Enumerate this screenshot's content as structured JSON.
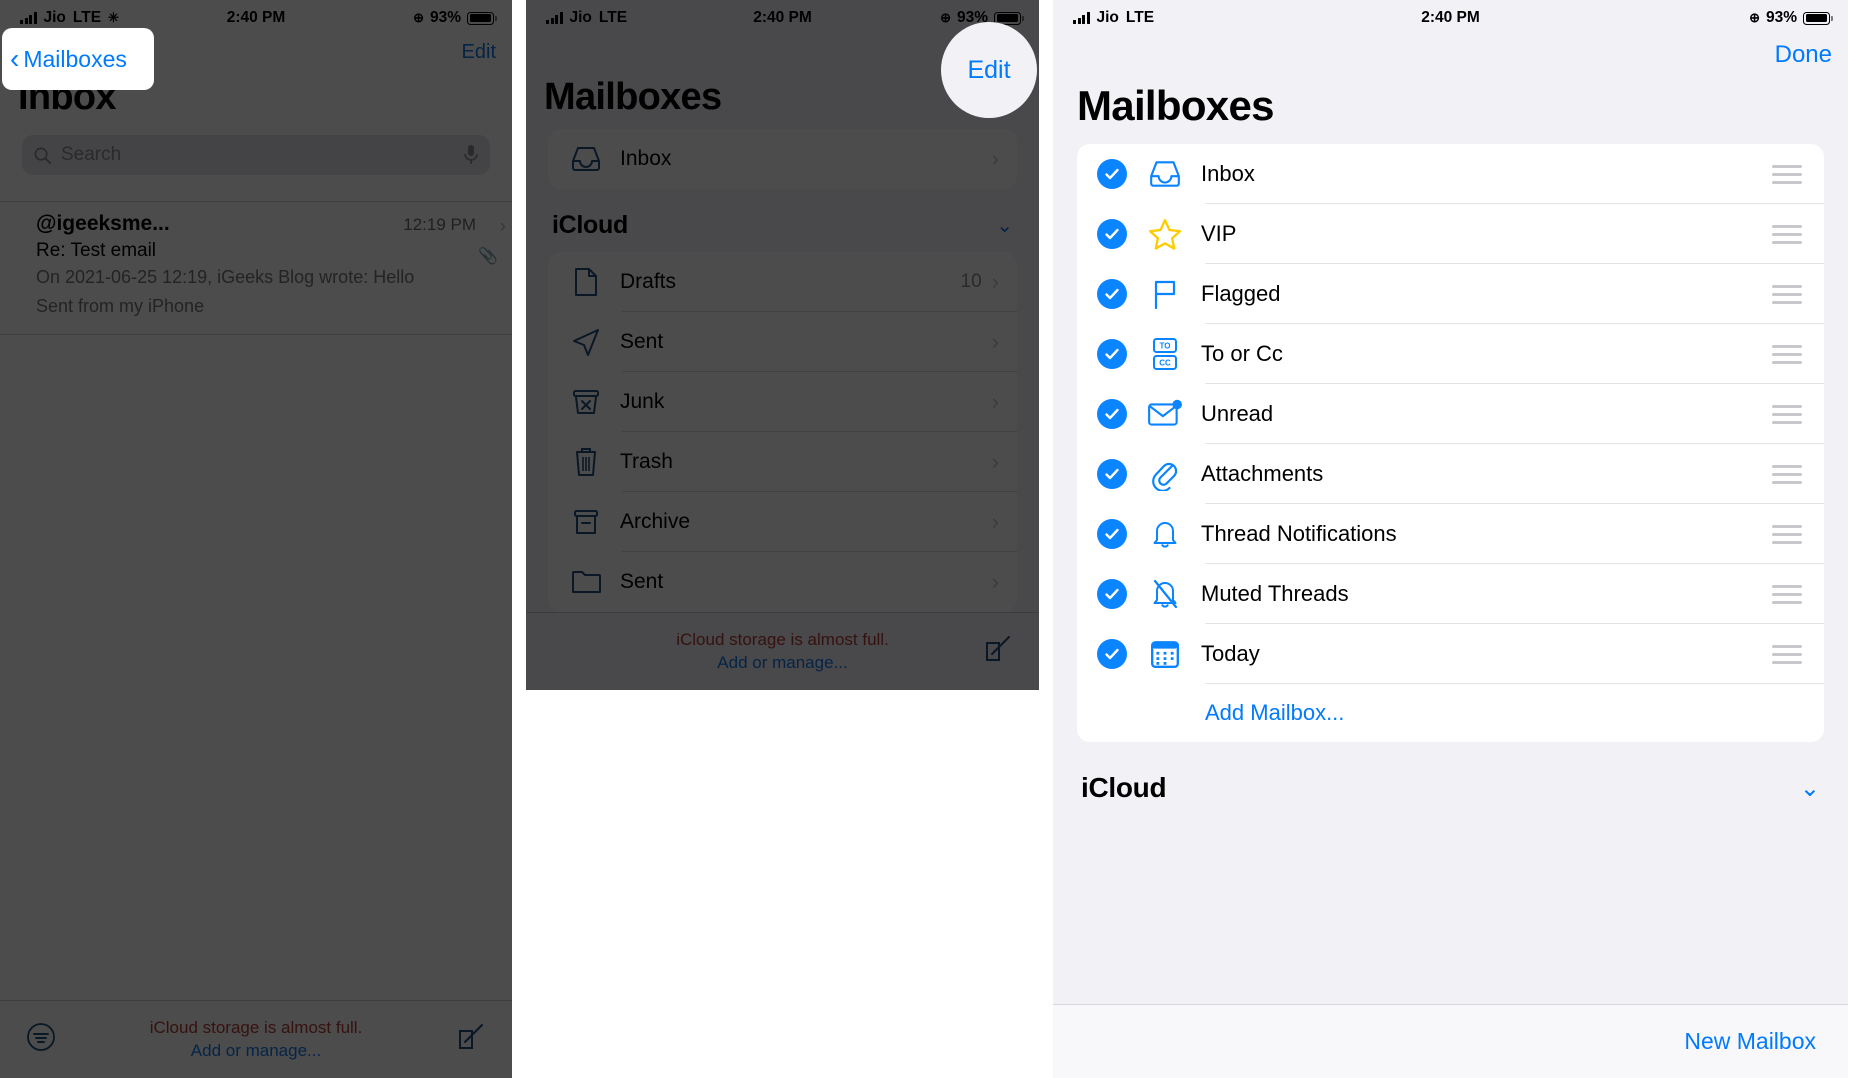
{
  "status_bar": {
    "carrier": "Jio",
    "network": "LTE",
    "time": "2:40 PM",
    "battery_percent": "93%",
    "signal_icon": "signal-bars-icon",
    "orientation_lock_icon": "rotation-lock-icon",
    "battery_icon": "battery-icon"
  },
  "panel1": {
    "back_label": "Mailboxes",
    "back_chevron_icon": "chevron-left-icon",
    "edit_label": "Edit",
    "title": "Inbox",
    "search": {
      "placeholder": "Search",
      "value": "",
      "search_icon": "search-icon",
      "mic_icon": "microphone-icon"
    },
    "messages": [
      {
        "sender": "@igeeksme...",
        "time": "12:19 PM",
        "subject": "Re: Test email",
        "preview_line1": "On 2021-06-25 12:19, iGeeks Blog wrote: Hello",
        "preview_line2": "Sent from my iPhone",
        "attachment_icon": "paperclip-icon",
        "disclosure_icon": "chevron-right-icon"
      }
    ],
    "toolbar": {
      "filter_icon": "filter-icon",
      "compose_icon": "compose-icon",
      "status_line1": "iCloud storage is almost full.",
      "status_line2": "Add or manage..."
    }
  },
  "panel2": {
    "edit_label": "Edit",
    "title": "Mailboxes",
    "primary_rows": [
      {
        "label": "Inbox",
        "icon": "inbox-tray-icon",
        "count": "",
        "disclosure_icon": "chevron-right-icon"
      }
    ],
    "group": {
      "title": "iCloud",
      "collapse_icon": "chevron-down-icon",
      "rows": [
        {
          "label": "Drafts",
          "icon": "document-icon",
          "count": "10",
          "disclosure_icon": "chevron-right-icon"
        },
        {
          "label": "Sent",
          "icon": "paper-plane-icon",
          "count": "",
          "disclosure_icon": "chevron-right-icon"
        },
        {
          "label": "Junk",
          "icon": "junk-bin-icon",
          "count": "",
          "disclosure_icon": "chevron-right-icon"
        },
        {
          "label": "Trash",
          "icon": "trash-icon",
          "count": "",
          "disclosure_icon": "chevron-right-icon"
        },
        {
          "label": "Archive",
          "icon": "archive-box-icon",
          "count": "",
          "disclosure_icon": "chevron-right-icon"
        },
        {
          "label": "Sent",
          "icon": "folder-icon",
          "count": "",
          "disclosure_icon": "chevron-right-icon"
        }
      ]
    },
    "toolbar": {
      "status_line1": "iCloud storage is almost full.",
      "status_line2": "Add or manage...",
      "compose_icon": "compose-icon"
    }
  },
  "panel3": {
    "done_label": "Done",
    "title": "Mailboxes",
    "rows": [
      {
        "label": "Inbox",
        "icon": "inbox-tray-icon",
        "checked": true,
        "grip_icon": "reorder-grip-icon"
      },
      {
        "label": "VIP",
        "icon": "star-icon",
        "checked": true,
        "grip_icon": "reorder-grip-icon"
      },
      {
        "label": "Flagged",
        "icon": "flag-icon",
        "checked": true,
        "grip_icon": "reorder-grip-icon"
      },
      {
        "label": "To or Cc",
        "icon": "to-or-cc-icon",
        "checked": true,
        "grip_icon": "reorder-grip-icon"
      },
      {
        "label": "Unread",
        "icon": "unread-envelope-icon",
        "checked": true,
        "grip_icon": "reorder-grip-icon"
      },
      {
        "label": "Attachments",
        "icon": "paperclip-icon",
        "checked": true,
        "grip_icon": "reorder-grip-icon"
      },
      {
        "label": "Thread Notifications",
        "icon": "bell-icon",
        "checked": true,
        "grip_icon": "reorder-grip-icon"
      },
      {
        "label": "Muted Threads",
        "icon": "bell-slash-icon",
        "checked": true,
        "grip_icon": "reorder-grip-icon"
      },
      {
        "label": "Today",
        "icon": "calendar-icon",
        "checked": true,
        "grip_icon": "reorder-grip-icon"
      }
    ],
    "add_mailbox_label": "Add Mailbox...",
    "group": {
      "title": "iCloud",
      "collapse_icon": "chevron-down-icon"
    },
    "new_mailbox_label": "New Mailbox"
  },
  "colors": {
    "accent_blue": "#007aff",
    "check_blue": "#0a84ff",
    "vip_yellow": "#ffcc00",
    "warning_red": "#c0392b",
    "system_bg": "#f2f1f6"
  }
}
